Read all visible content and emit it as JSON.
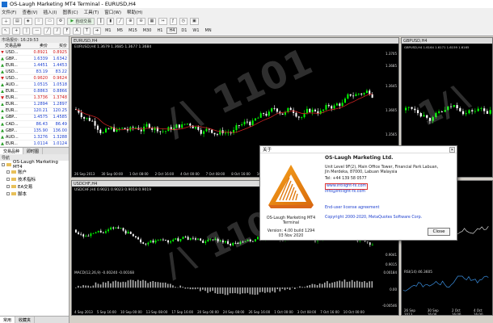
{
  "window": {
    "title": "OS-Laugh Marketing MT4 Terminal - EURUSD,H4"
  },
  "menu": [
    "文件(F)",
    "查看(V)",
    "插入(I)",
    "图表(C)",
    "工具(T)",
    "窗口(W)",
    "帮助(H)"
  ],
  "toolbar": {
    "autotrade_label": "自动交易",
    "timeframes": [
      "M1",
      "M5",
      "M15",
      "M30",
      "H1",
      "H4",
      "D1",
      "W1",
      "MN"
    ]
  },
  "market_watch": {
    "title": "市场报价: 16:29:53",
    "columns": [
      "交易品种",
      "卖价",
      "买价"
    ],
    "rows": [
      {
        "symbol": "USD...",
        "bid": "0.8921",
        "ask": "0.8925",
        "dir": "dn"
      },
      {
        "symbol": "GBP...",
        "bid": "1.6339",
        "ask": "1.6342",
        "dir": "up"
      },
      {
        "symbol": "EUR...",
        "bid": "1.4451",
        "ask": "1.4453",
        "dir": "up"
      },
      {
        "symbol": "USD...",
        "bid": "83.19",
        "ask": "83.22",
        "dir": "up"
      },
      {
        "symbol": "USD...",
        "bid": "0.9620",
        "ask": "0.9624",
        "dir": "dn"
      },
      {
        "symbol": "AUD...",
        "bid": "1.0515",
        "ask": "1.0518",
        "dir": "up"
      },
      {
        "symbol": "EUR...",
        "bid": "0.8863",
        "ask": "0.8866",
        "dir": "up"
      },
      {
        "symbol": "EUR...",
        "bid": "1.3736",
        "ask": "1.3748",
        "dir": "dn"
      },
      {
        "symbol": "EUR...",
        "bid": "1.2894",
        "ask": "1.2897",
        "dir": "up"
      },
      {
        "symbol": "EUR...",
        "bid": "120.21",
        "ask": "120.25",
        "dir": "up"
      },
      {
        "symbol": "GBP...",
        "bid": "1.4575",
        "ask": "1.4585",
        "dir": "up"
      },
      {
        "symbol": "CAD...",
        "bid": "86.43",
        "ask": "86.49",
        "dir": "up"
      },
      {
        "symbol": "GBP...",
        "bid": "135.90",
        "ask": "136.00",
        "dir": "up"
      },
      {
        "symbol": "AUD...",
        "bid": "1.3276",
        "ask": "1.3288",
        "dir": "up"
      },
      {
        "symbol": "EUR...",
        "bid": "1.0114",
        "ask": "1.0124",
        "dir": "up"
      }
    ],
    "tabs": [
      "交易品种",
      "即时图"
    ]
  },
  "navigator": {
    "title": "导航",
    "root": "OS-Laugh Marketing MT4",
    "items": [
      "账户",
      "技术指标",
      "EA交易",
      "脚本"
    ],
    "bottom_tabs": [
      "常用",
      "收藏夹"
    ]
  },
  "charts": {
    "eurusd_h4": {
      "title": "EURUSD,H4",
      "info": "EURUSD,H4  1.3679 1.3685 1.3677 1.3684",
      "axis": [
        "1.3705",
        "1.3685",
        "1.3645",
        "1.3605",
        "1.3565",
        "1.3525"
      ],
      "times": [
        "26 Sep 2013",
        "30 Sep 00:00",
        "1 Oct 08:00",
        "2 Oct 16:00",
        "4 Oct 00:00",
        "7 Oct 08:00",
        "8 Oct 16:00",
        "10 Oct 00:00",
        "11 Oct 08:00"
      ]
    },
    "gbpusd_h4": {
      "title": "GBPUSD,H4",
      "info": "GBPUSD,H4  1.6164 1.6171 1.6159 1.6165",
      "times": [
        "26 Sep 2013",
        "1 Oct 08:00"
      ]
    },
    "usdchf_h4": {
      "title": "USDCHF,H4",
      "info": "USDCHF,H4  0.9021 0.9023 0.9018 0.9019",
      "axis": [
        "0.9041",
        "0.9015"
      ],
      "macd": "MACD(12,26,9) -0.00240 -0.00168",
      "macd_axis": [
        "0.00184",
        "0.00",
        "-0.00546"
      ],
      "times": [
        "4 Sep 2013",
        "5 Sep 16:00",
        "10 Sep 00:00",
        "13 Sep 08:00",
        "17 Sep 16:00",
        "20 Sep 00:00",
        "24 Sep 08:00",
        "26 Sep 16:00",
        "1 Oct 00:00",
        "3 Oct 08:00",
        "7 Oct 16:00",
        "10 Oct 00:00"
      ]
    },
    "small_right": {
      "rsi": "RSI(14) 46.3605",
      "times": [
        "26 Sep 2013",
        "30 Sep 16:00",
        "2 Oct 16:00",
        "4 Oct 16:00"
      ]
    }
  },
  "about_dialog": {
    "title": "关于",
    "company": "OS-Laugh Marketing Ltd.",
    "address": [
      "Unit Level 9F(2), Main Office Tower, Financial Park Labuan,",
      "Jln Merdeka, 87000, Labuan Malaysia"
    ],
    "tel": "Tel: +44 139 58 0577",
    "website": "www.intllight-fx.com",
    "email": "info@intllight-fx.com",
    "product": "OS-Laugh Marketing MT4",
    "product_sub": "Terminal",
    "version": "Version: 4.00 build 1294",
    "date": "03 Nov 2020",
    "license_link": "End-user license agreement",
    "copyright": "Copyright 2000-2020, MetaQuotes Software Corp.",
    "close_label": "Close"
  },
  "colors": {
    "bull": "#00ff00",
    "bear": "#ffffff",
    "ma": "#cc2222",
    "chart_bg": "#000000",
    "link": "#1d3fcf"
  }
}
